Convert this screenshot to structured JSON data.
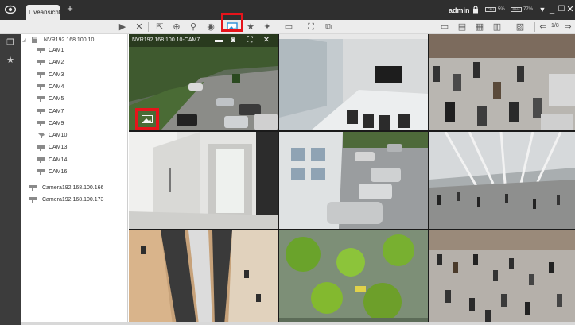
{
  "app": {
    "tab_label": "Liveansicht",
    "tab_add": "+",
    "user": "admin",
    "cpu_label": "CPU",
    "cpu_value": "5%",
    "ram_label": "RAM",
    "ram_value": "77%",
    "minimize": "_",
    "maximize": "☐",
    "close": "✕",
    "dropdown": "▼"
  },
  "toolbar": {
    "page": "1/8",
    "highlight_color": "#e6141b"
  },
  "tree": {
    "nvr": "NVR192.168.100.10",
    "cams": [
      "CAM1",
      "CAM2",
      "CAM3",
      "CAM4",
      "CAM5",
      "CAM7",
      "CAM9",
      "CAM10",
      "CAM13",
      "CAM14",
      "CAM16"
    ],
    "cam_icons": [
      "camera-icon",
      "camera-icon",
      "camera-icon",
      "camera-icon",
      "camera-icon",
      "camera-icon",
      "camera-icon",
      "ptz-camera-icon",
      "camera-icon",
      "camera-icon",
      "camera-icon"
    ],
    "standalone": [
      "Camera192.168.100.166",
      "Camera192.168.100.173"
    ]
  },
  "grid": {
    "selected_title": "NVR192.168.100.10-CAM7"
  }
}
